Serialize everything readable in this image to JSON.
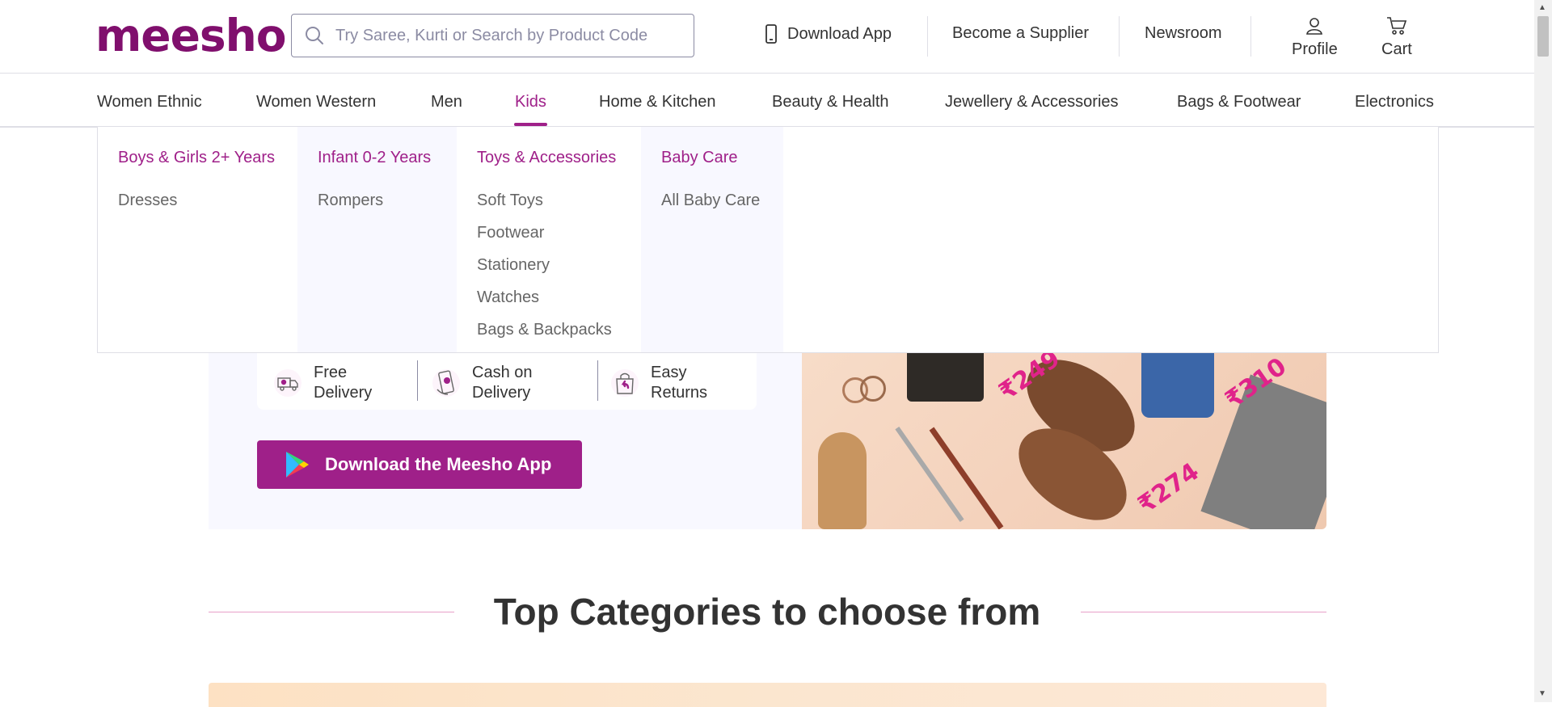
{
  "header": {
    "logo": "meesho",
    "search_placeholder": "Try Saree, Kurti or Search by Product Code",
    "download_app": "Download App",
    "become_supplier": "Become a Supplier",
    "newsroom": "Newsroom",
    "profile": "Profile",
    "cart": "Cart"
  },
  "nav": {
    "items": [
      {
        "label": "Women Ethnic"
      },
      {
        "label": "Women Western"
      },
      {
        "label": "Men"
      },
      {
        "label": "Kids"
      },
      {
        "label": "Home & Kitchen"
      },
      {
        "label": "Beauty & Health"
      },
      {
        "label": "Jewellery & Accessories"
      },
      {
        "label": "Bags & Footwear"
      },
      {
        "label": "Electronics"
      }
    ],
    "active": "Kids"
  },
  "dropdown": {
    "columns": [
      {
        "title": "Boys & Girls 2+ Years",
        "items": [
          "Dresses"
        ]
      },
      {
        "title": "Infant 0-2 Years",
        "items": [
          "Rompers"
        ]
      },
      {
        "title": "Toys & Accessories",
        "items": [
          "Soft Toys",
          "Footwear",
          "Stationery",
          "Watches",
          "Bags & Backpacks"
        ]
      },
      {
        "title": "Baby Care",
        "items": [
          "All Baby Care"
        ]
      }
    ]
  },
  "hero": {
    "features": [
      {
        "line1": "Free",
        "line2": "Delivery",
        "icon": "delivery-truck-icon"
      },
      {
        "line1": "Cash on",
        "line2": "Delivery",
        "icon": "cash-hand-icon"
      },
      {
        "line1": "Easy",
        "line2": "Returns",
        "icon": "return-bag-icon"
      }
    ],
    "app_button": "Download the Meesho App",
    "price_tags": [
      "₹249",
      "₹310",
      "₹274"
    ]
  },
  "section": {
    "title": "Top Categories to choose from"
  },
  "colors": {
    "brand": "#9f2089",
    "logo": "#800f6d",
    "text": "#333333",
    "muted": "#666666"
  }
}
